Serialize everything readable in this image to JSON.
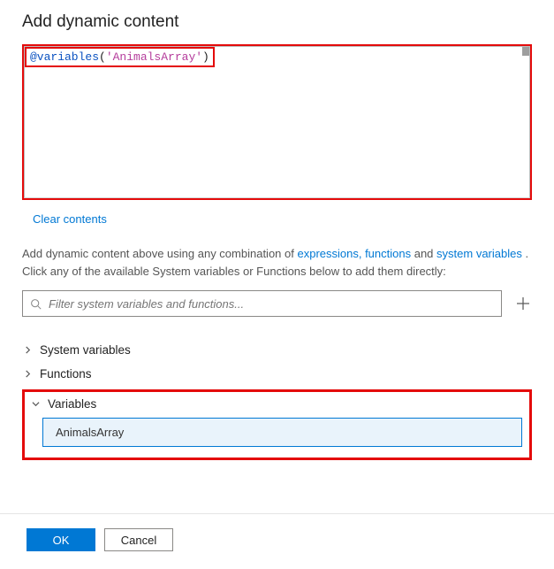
{
  "title": "Add dynamic content",
  "expression": {
    "func": "@variables",
    "open": "(",
    "string": "'AnimalsArray'",
    "close": ")"
  },
  "clear_link": "Clear contents",
  "hint": {
    "pre": "Add dynamic content above using any combination of ",
    "link1": "expressions, functions",
    "mid": " and ",
    "link2": "system variables",
    "post": " . Click any of the available System variables or Functions below to add them directly:"
  },
  "filter": {
    "placeholder": "Filter system variables and functions..."
  },
  "groups": {
    "system": "System variables",
    "functions": "Functions",
    "variables": "Variables"
  },
  "variable_items": [
    "AnimalsArray"
  ],
  "buttons": {
    "ok": "OK",
    "cancel": "Cancel"
  }
}
